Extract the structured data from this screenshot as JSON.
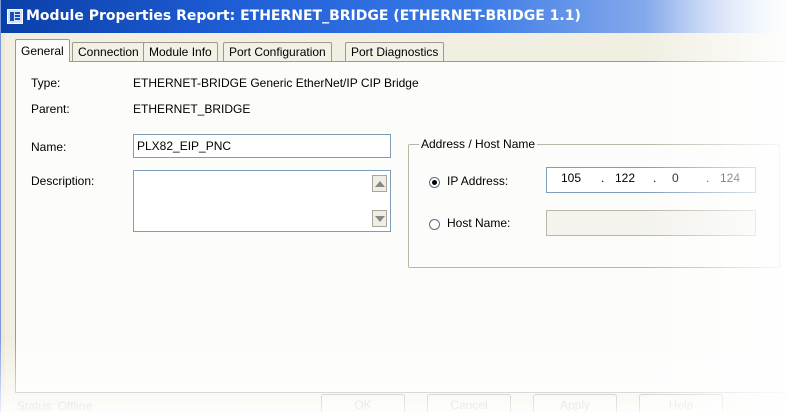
{
  "window": {
    "title": "Module Properties Report: ETHERNET_BRIDGE (ETHERNET-BRIDGE 1.1)",
    "icon": "module-properties-icon"
  },
  "tabs": [
    {
      "label": "General",
      "active": true
    },
    {
      "label": "Connection"
    },
    {
      "label": "Module Info"
    },
    {
      "label": "Port Configuration"
    },
    {
      "label": "Port Diagnostics"
    }
  ],
  "general": {
    "type_label": "Type:",
    "type_value": "ETHERNET-BRIDGE Generic EtherNet/IP CIP Bridge",
    "parent_label": "Parent:",
    "parent_value": "ETHERNET_BRIDGE",
    "name_label": "Name:",
    "name_value": "PLX82_EIP_PNC",
    "description_label": "Description:",
    "description_value": ""
  },
  "address": {
    "group_title": "Address / Host Name",
    "ip_label": "IP Address:",
    "ip_selected": true,
    "ip_octets": [
      "105",
      "122",
      "0",
      "124"
    ],
    "host_label": "Host Name:",
    "host_value": ""
  },
  "status": {
    "text": "Status: Offline"
  },
  "buttons": {
    "ok": "OK",
    "cancel": "Cancel",
    "apply": "Apply",
    "help": "Help"
  }
}
